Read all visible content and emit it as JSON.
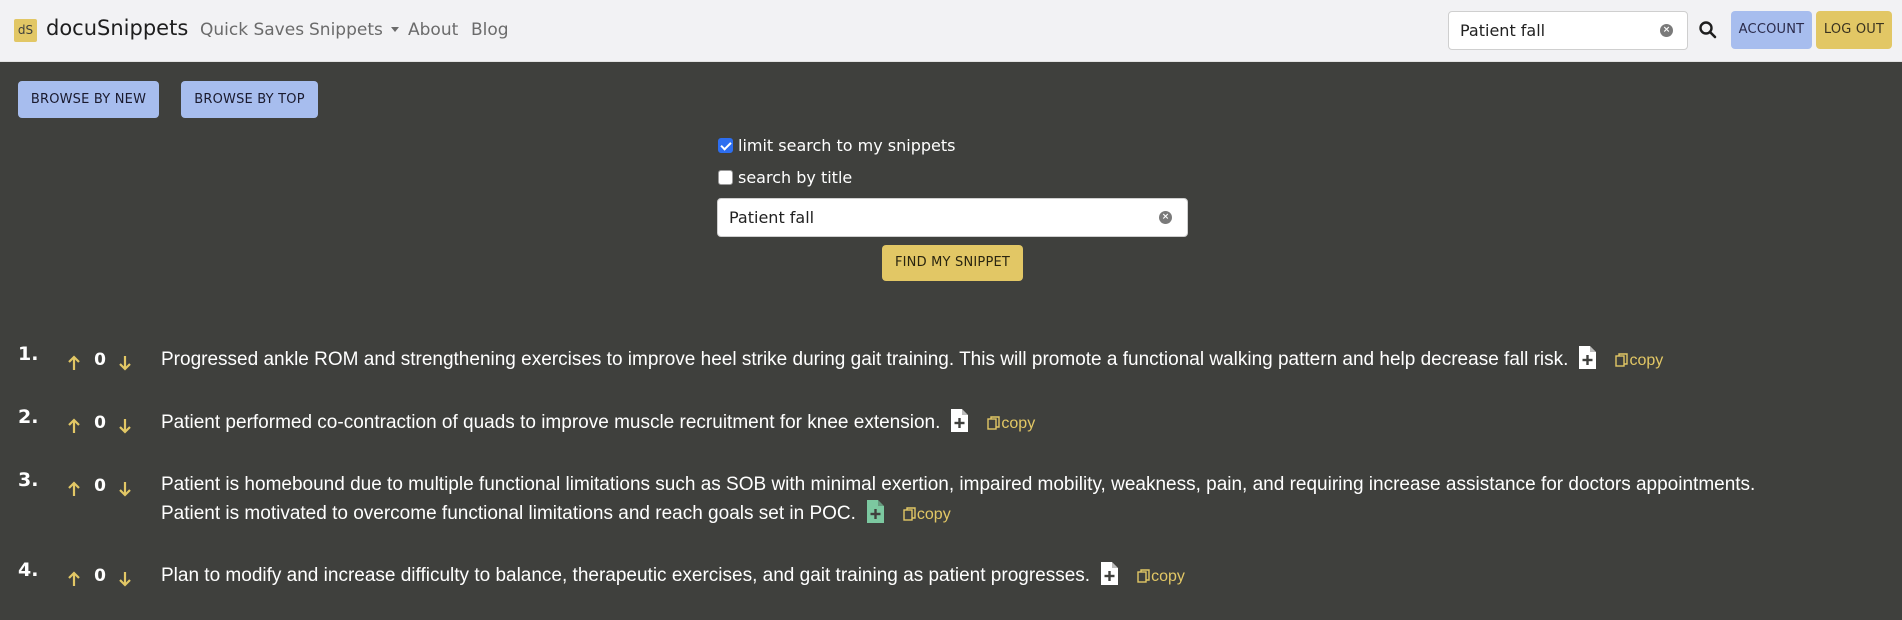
{
  "brand": {
    "logo_text": "dS",
    "name": "docuSnippets"
  },
  "nav": {
    "quick_saves": "Quick Saves",
    "snippets": "Snippets",
    "about": "About",
    "blog": "Blog",
    "search_value": "Patient fall",
    "account": "ACCOUNT",
    "logout": "LOG OUT"
  },
  "browse": {
    "by_new": "BROWSE BY NEW",
    "by_top": "BROWSE BY TOP"
  },
  "search": {
    "limit_label": "limit search to my snippets",
    "limit_checked": true,
    "title_label": "search by title",
    "title_checked": false,
    "value": "Patient fall",
    "find_button": "FIND MY SNIPPET"
  },
  "copy_label": "copy",
  "colors": {
    "accent_yellow": "#e2c765",
    "accent_blue": "#a7bdee",
    "background": "#3f403d",
    "file_icon_highlight": "#7cc8a0"
  },
  "results": [
    {
      "num": "1.",
      "votes": "0",
      "icon": "file-plus-icon",
      "text": "Progressed ankle ROM and strengthening exercises to improve heel strike during gait training. This will promote a functional walking pattern and help decrease fall risk."
    },
    {
      "num": "2.",
      "votes": "0",
      "icon": "file-plus-icon",
      "text": "Patient performed co-contraction of quads to improve muscle recruitment for knee extension."
    },
    {
      "num": "3.",
      "votes": "0",
      "icon": "file-plus-icon",
      "text": "Patient is homebound due to multiple functional limitations such as SOB with minimal exertion, impaired mobility, weakness, pain, and requiring increase assistance for doctors appointments. Patient is motivated to overcome functional limitations and reach goals set in POC."
    },
    {
      "num": "4.",
      "votes": "0",
      "icon": "file-plus-icon",
      "text": "Plan to modify and increase difficulty to balance, therapeutic exercises, and gait training as patient progresses."
    }
  ]
}
